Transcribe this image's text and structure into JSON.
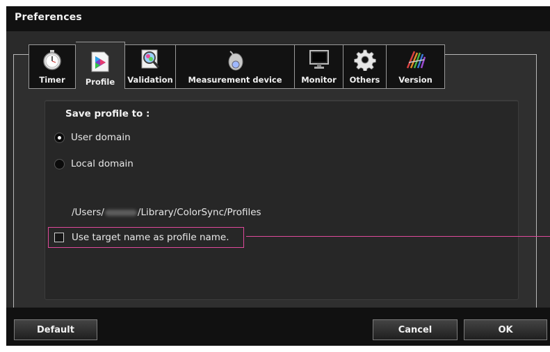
{
  "window": {
    "title": "Preferences"
  },
  "tabs": [
    {
      "label": "Timer",
      "icon": "stopwatch-icon"
    },
    {
      "label": "Profile",
      "icon": "color-profile-icon"
    },
    {
      "label": "Validation",
      "icon": "magnifier-icon"
    },
    {
      "label": "Measurement device",
      "icon": "colorimeter-icon"
    },
    {
      "label": "Monitor",
      "icon": "monitor-icon"
    },
    {
      "label": "Others",
      "icon": "gear-icon"
    },
    {
      "label": "Version",
      "icon": "version-logo-icon"
    }
  ],
  "selected_tab": "Profile",
  "profile": {
    "heading": "Save profile to :",
    "options": [
      "User domain",
      "Local domain"
    ],
    "selected_option": "User domain",
    "path_prefix": "/Users/",
    "path_suffix": "/Library/ColorSync/Profiles",
    "checkbox_label": "Use target name as profile name.",
    "checkbox_checked": false
  },
  "buttons": {
    "default": "Default",
    "cancel": "Cancel",
    "ok": "OK"
  },
  "colors": {
    "highlight": "#e04a9c",
    "background": "#111111"
  }
}
